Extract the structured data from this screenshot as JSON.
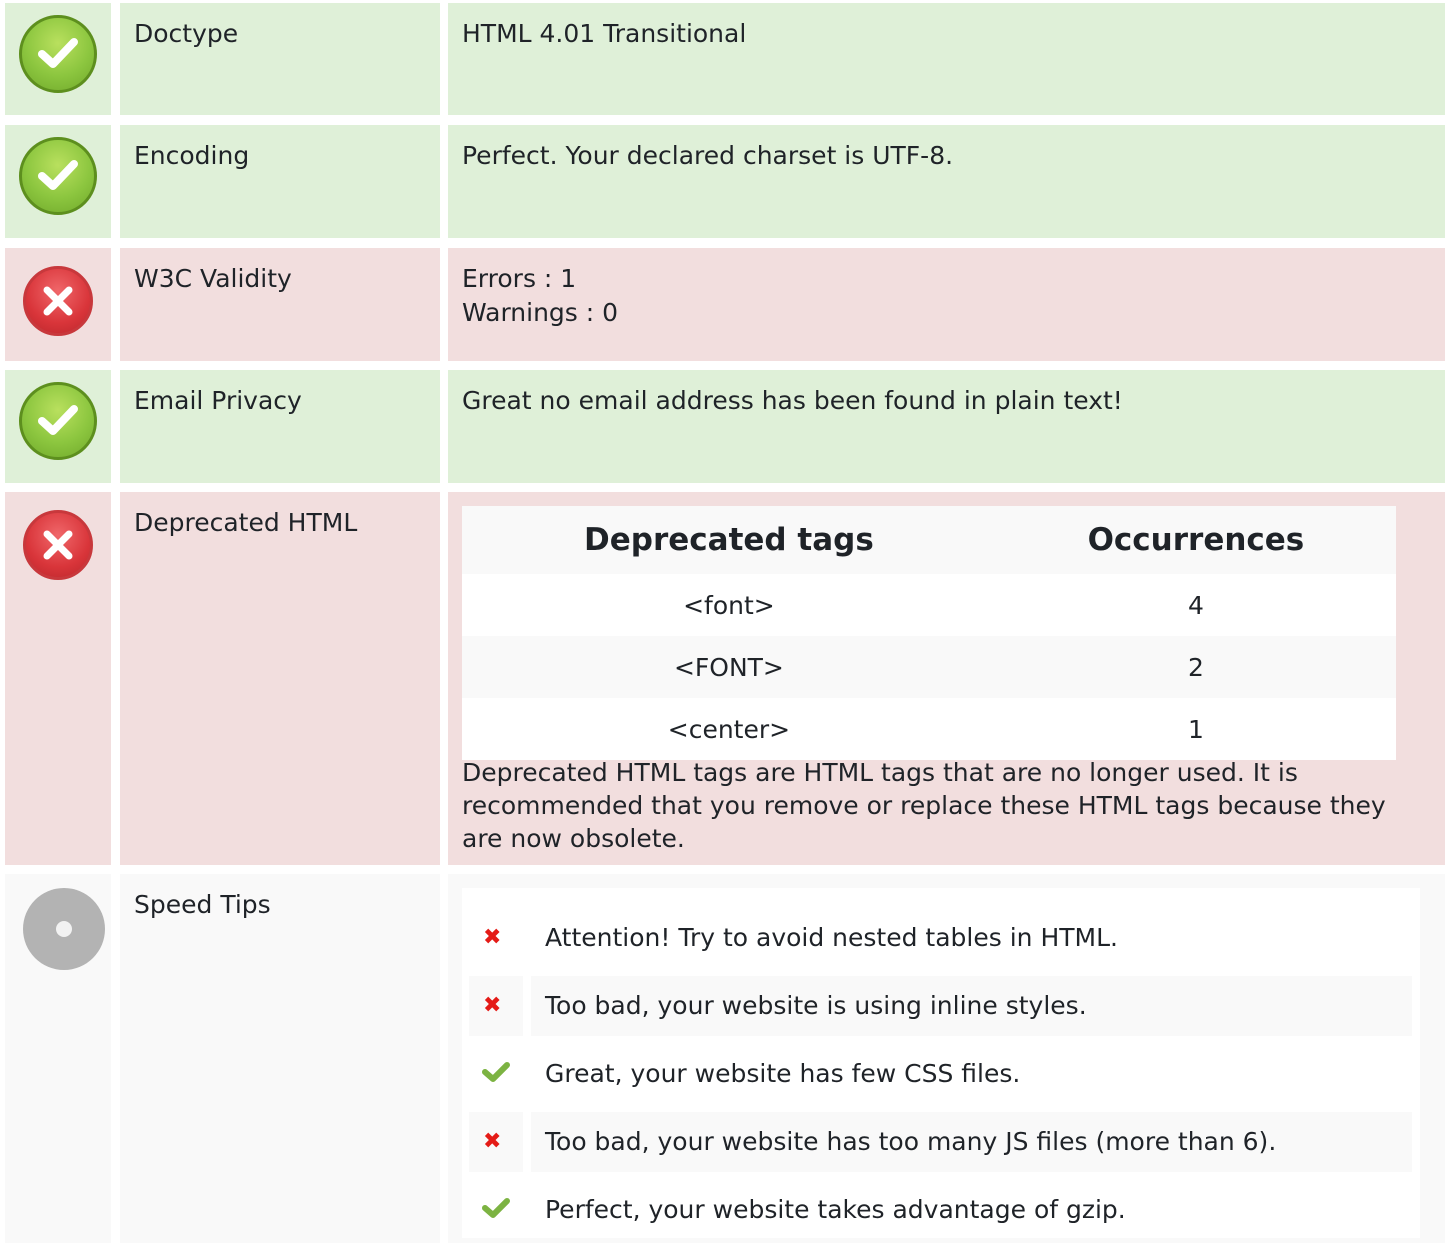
{
  "rows": {
    "doctype": {
      "label": "Doctype",
      "value": "HTML 4.01 Transitional",
      "status": "ok"
    },
    "encoding": {
      "label": "Encoding",
      "value": "Perfect. Your declared charset is UTF-8.",
      "status": "ok"
    },
    "w3c": {
      "label": "W3C Validity",
      "errors": "Errors : 1",
      "warnings": "Warnings : 0",
      "status": "bad"
    },
    "email": {
      "label": "Email Privacy",
      "value": "Great no email address has been found in plain text!",
      "status": "ok"
    },
    "deprecated": {
      "label": "Deprecated HTML",
      "status": "bad",
      "columns": [
        "Deprecated tags",
        "Occurrences"
      ],
      "rows": [
        {
          "tag": "<font>",
          "count": "4"
        },
        {
          "tag": "<FONT>",
          "count": "2"
        },
        {
          "tag": "<center>",
          "count": "1"
        }
      ],
      "note": "Deprecated HTML tags are HTML tags that are no longer used. It is recommended that you remove or replace these HTML tags because they are now obsolete."
    },
    "speed": {
      "label": "Speed Tips",
      "status": "neutral",
      "tips": [
        {
          "status": "bad",
          "text": "Attention! Try to avoid nested tables in HTML."
        },
        {
          "status": "bad",
          "text": "Too bad, your website is using inline styles."
        },
        {
          "status": "ok",
          "text": "Great, your website has few CSS files."
        },
        {
          "status": "bad",
          "text": "Too bad, your website has too many JS files (more than 6)."
        },
        {
          "status": "ok",
          "text": "Perfect, your website takes advantage of gzip."
        }
      ]
    }
  },
  "colors": {
    "ok_bg": "#dff0d8",
    "bad_bg": "#f2dede",
    "neutral_bg": "#f9f9f9",
    "ok_icon": "#8cc63f",
    "bad_icon": "#d9353a",
    "x_mark": "#e41b17",
    "check_mark": "#7cb342"
  }
}
